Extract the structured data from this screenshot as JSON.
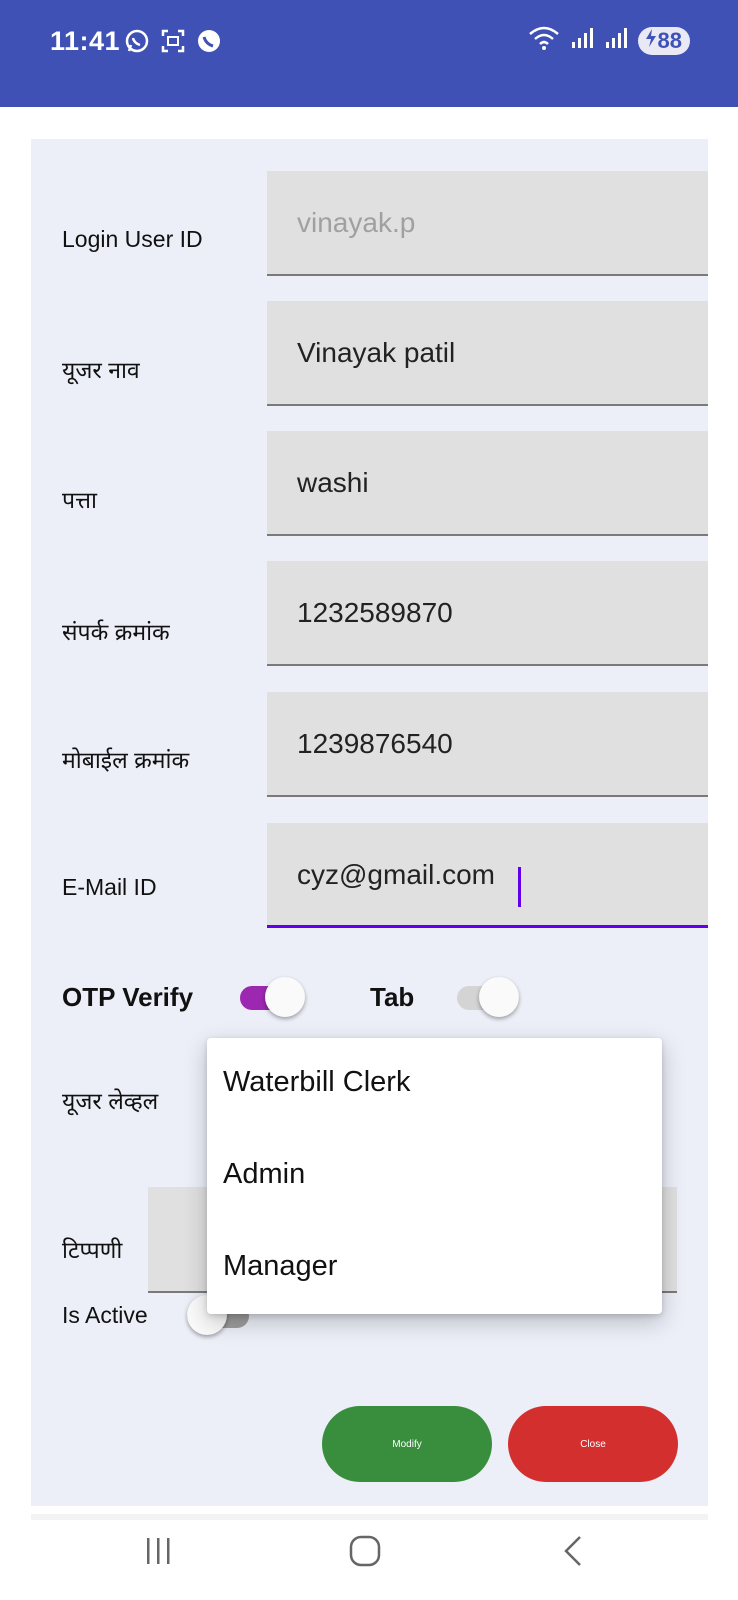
{
  "status_bar": {
    "time": "11:41",
    "battery": "88",
    "icons_left": [
      "whatsapp-icon",
      "screenshot-icon",
      "viber-icon"
    ],
    "icons_right": [
      "wifi-icon",
      "signal-icon",
      "signal-icon",
      "battery-charging-icon"
    ]
  },
  "form": {
    "login_user_id": {
      "label": "Login User ID",
      "value": "vinayak.p"
    },
    "user_name": {
      "label": "यूजर नाव",
      "value": "Vinayak patil"
    },
    "address": {
      "label": "पत्ता",
      "value": "washi"
    },
    "contact_number": {
      "label": "संपर्क क्रमांक",
      "value": "1232589870"
    },
    "mobile_number": {
      "label": "मोबाईल क्रमांक",
      "value": "1239876540"
    },
    "email": {
      "label": "E-Mail ID",
      "value": "cyz@gmail.com"
    },
    "otp_verify": {
      "label": "OTP Verify",
      "on": true
    },
    "tab": {
      "label": "Tab",
      "on": false
    },
    "user_level": {
      "label": "यूजर लेव्हल"
    },
    "remark": {
      "label": "टिप्पणी",
      "value": ""
    },
    "is_active": {
      "label": "Is Active",
      "on": false
    }
  },
  "dropdown": {
    "options": [
      "Waterbill Clerk",
      "Admin",
      "Manager"
    ]
  },
  "buttons": {
    "modify": "Modify",
    "close": "Close"
  },
  "colors": {
    "status_bar": "#3f51b5",
    "card_bg": "#eceff8",
    "accent": "#6200ee",
    "switch_on": "#9c27b0",
    "modify_button": "#388e3c",
    "close_button": "#d32f2f"
  },
  "nav_bar": [
    "recents-icon",
    "home-icon",
    "back-icon"
  ]
}
